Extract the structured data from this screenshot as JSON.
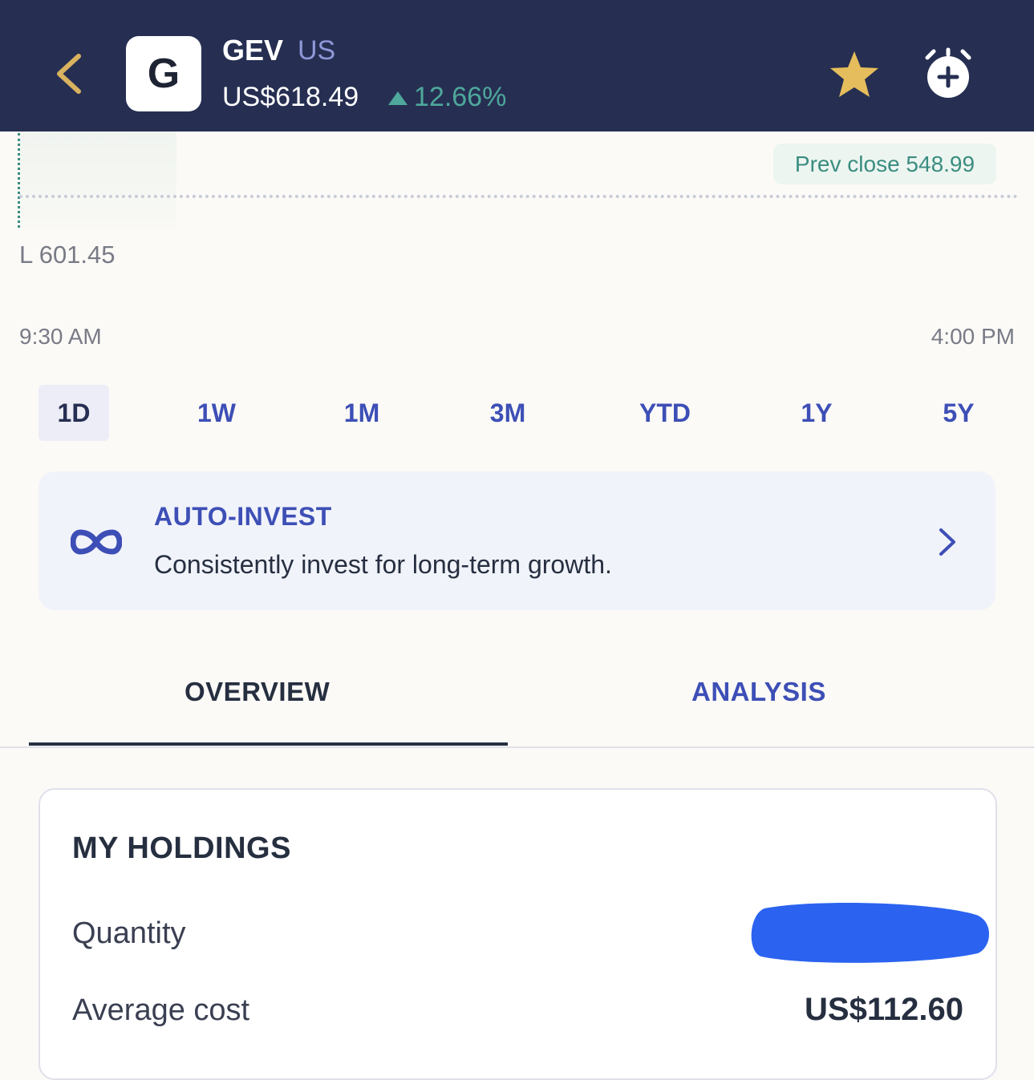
{
  "header": {
    "logo_letter": "G",
    "ticker": "GEV",
    "exchange": "US",
    "price": "US$618.49",
    "change_pct": "12.66%",
    "change_direction": "up",
    "icons": [
      "back-chevron-icon",
      "star-icon",
      "alarm-add-icon"
    ]
  },
  "chart": {
    "prev_close_label": "Prev close 548.99",
    "low_label": "L 601.45",
    "time_start": "9:30 AM",
    "time_end": "4:00 PM"
  },
  "ranges": {
    "items": [
      "1D",
      "1W",
      "1M",
      "3M",
      "YTD",
      "1Y",
      "5Y"
    ],
    "selected": "1D"
  },
  "auto_invest": {
    "title": "AUTO-INVEST",
    "subtitle": "Consistently invest for long-term growth.",
    "icon": "infinity-icon"
  },
  "tabs": {
    "overview": "OVERVIEW",
    "analysis": "ANALYSIS",
    "active": "OVERVIEW"
  },
  "holdings": {
    "title": "MY HOLDINGS",
    "quantity_label": "Quantity",
    "quantity_value": "",
    "average_cost_label": "Average cost",
    "average_cost_value": "US$112.60"
  },
  "colors": {
    "header_bg": "#262f52",
    "accent_blue": "#3d4fb6",
    "positive_green": "#4ea89b",
    "star_gold": "#e5bd5c",
    "back_gold": "#d9b25f",
    "redaction_blue": "#2b63f0"
  }
}
